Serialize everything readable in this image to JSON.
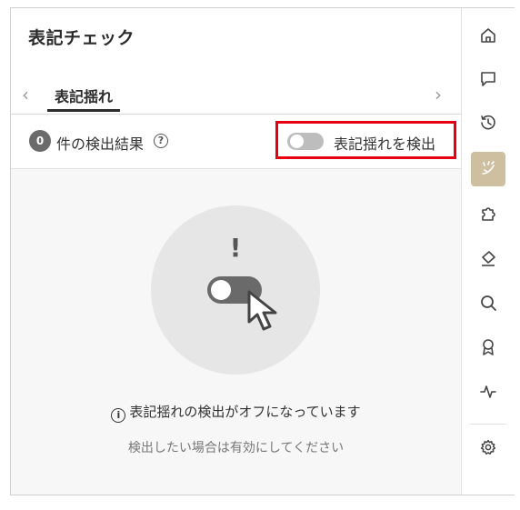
{
  "panel": {
    "title": "表記チェック",
    "tabs": [
      {
        "label": "表記揺れ",
        "active": true
      }
    ],
    "prev_arrow": "‹",
    "next_arrow": "›"
  },
  "results": {
    "count": "0",
    "label": "件の検出結果",
    "help_glyph": "?",
    "toggle_label": "表記揺れを検出",
    "toggle_on": false
  },
  "empty_state": {
    "exclamation": "!",
    "info_glyph": "i",
    "message": "表記揺れの検出がオフになっています",
    "hint": "検出したい場合は有効にしてください"
  },
  "sidebar": {
    "items": [
      {
        "icon": "home-icon"
      },
      {
        "icon": "chat-icon"
      },
      {
        "icon": "history-icon"
      },
      {
        "icon": "notation-check-icon",
        "active": true
      },
      {
        "icon": "puzzle-icon"
      },
      {
        "icon": "eraser-icon"
      },
      {
        "icon": "search-icon"
      },
      {
        "icon": "award-icon"
      },
      {
        "icon": "activity-icon"
      },
      {
        "icon": "settings-icon"
      }
    ]
  },
  "colors": {
    "highlight_border": "#e60012",
    "active_sidebar": "#cdbf9f",
    "badge": "#6b6b6b"
  }
}
